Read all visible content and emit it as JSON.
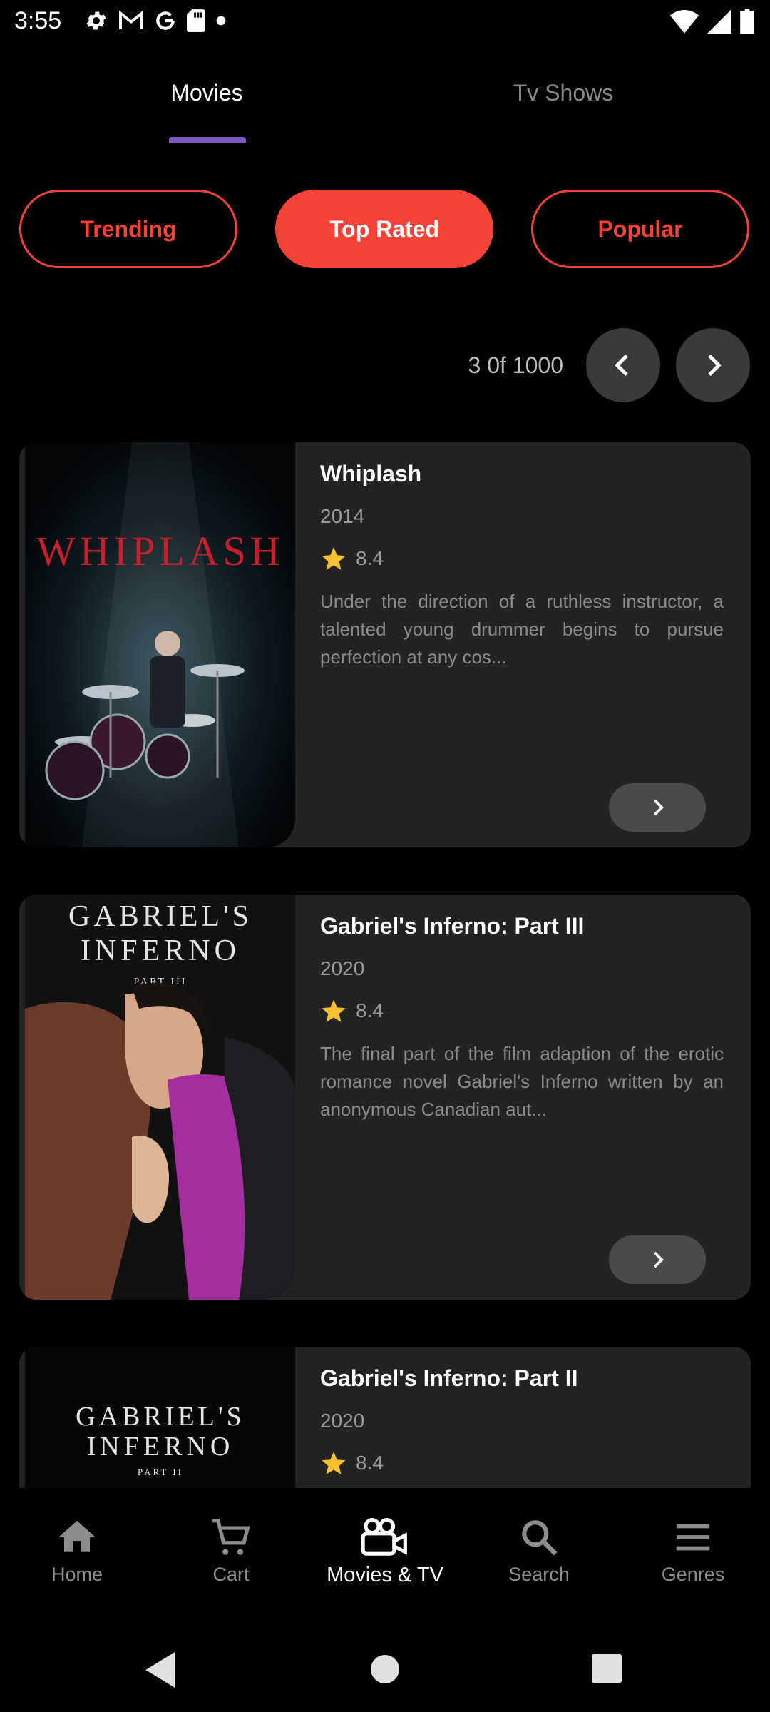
{
  "status_bar": {
    "time": "3:55",
    "left_icons": [
      "settings-icon",
      "gmail-icon",
      "google-icon",
      "sd-card-icon",
      "dot-icon"
    ],
    "right_icons": [
      "wifi-icon",
      "signal-icon",
      "battery-icon"
    ]
  },
  "tabs": [
    {
      "label": "Movies",
      "active": true
    },
    {
      "label": "Tv Shows",
      "active": false
    }
  ],
  "filters": [
    {
      "label": "Trending",
      "active": false
    },
    {
      "label": "Top Rated",
      "active": true
    },
    {
      "label": "Popular",
      "active": false
    }
  ],
  "pager": {
    "text": "3 0f 1000"
  },
  "movies": [
    {
      "title": "Whiplash",
      "year": "2014",
      "rating": "8.4",
      "description": "Under the direction of a ruthless instructor, a talented young drummer begins to pursue perfection at any cos...",
      "poster_text": "WHIPLASH"
    },
    {
      "title": "Gabriel's Inferno: Part III",
      "year": "2020",
      "rating": "8.4",
      "description": "The final part of the film adaption of the erotic romance novel Gabriel's Inferno written by an anonymous Canadian aut...",
      "poster_title_1": "GABRIEL'S",
      "poster_title_2": "INFERNO",
      "poster_sub": "PART III"
    },
    {
      "title": "Gabriel's Inferno: Part II",
      "year": "2020",
      "rating": "8.4",
      "poster_title_1": "GABRIEL'S",
      "poster_title_2": "INFERNO",
      "poster_sub": "PART II"
    }
  ],
  "bottom_nav": [
    {
      "label": "Home",
      "icon": "home-icon",
      "active": false
    },
    {
      "label": "Cart",
      "icon": "cart-icon",
      "active": false
    },
    {
      "label": "Movies & TV",
      "icon": "movie-camera-icon",
      "active": true
    },
    {
      "label": "Search",
      "icon": "search-icon",
      "active": false
    },
    {
      "label": "Genres",
      "icon": "menu-icon",
      "active": false
    }
  ],
  "colors": {
    "accent": "#f44336",
    "tab_indicator": "#7c5cc4",
    "card_bg": "#232323",
    "star": "#fbc02d"
  }
}
